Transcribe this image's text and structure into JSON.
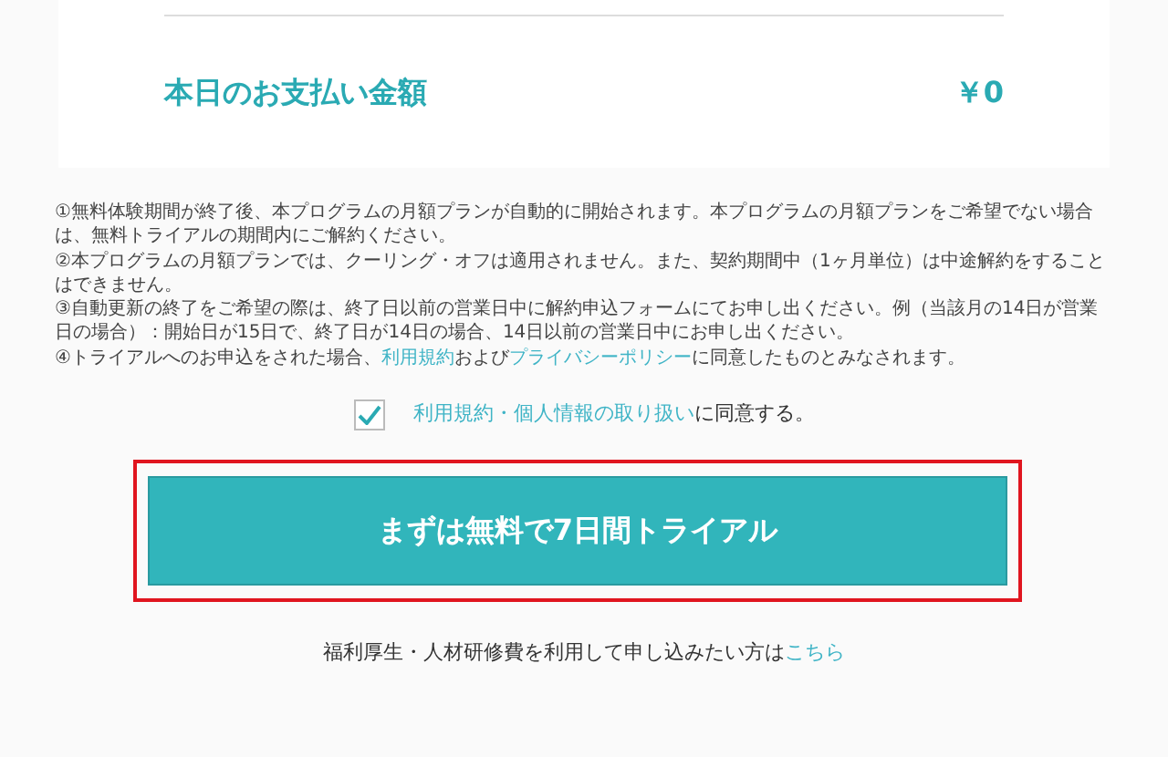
{
  "summary": {
    "label": "本日のお支払い金額",
    "amount": "￥0"
  },
  "notes": [
    {
      "parts": [
        {
          "kind": "text",
          "text": "①無料体験期間が終了後、本プログラムの月額プランが自動的に開始されます。本プログラムの月額プランをご希望でない場合は、無料トライアルの期間内にご解約ください。"
        }
      ]
    },
    {
      "parts": [
        {
          "kind": "text",
          "text": "②本プログラムの月額プランでは、クーリング・オフは適用されません。また、契約期間中（1ヶ月単位）は中途解約をすることはできません。"
        }
      ]
    },
    {
      "parts": [
        {
          "kind": "text",
          "text": "③自動更新の終了をご希望の際は、終了日以前の営業日中に解約申込フォームにてお申し出ください。例（当該月の14日が営業日の場合）：開始日が15日で、終了日が14日の場合、14日以前の営業日中にお申し出ください。"
        }
      ]
    },
    {
      "parts": [
        {
          "kind": "text",
          "text": "④トライアルへのお申込をされた場合、"
        },
        {
          "kind": "link",
          "text": "利用規約"
        },
        {
          "kind": "text",
          "text": "および"
        },
        {
          "kind": "link",
          "text": "プライバシーポリシー"
        },
        {
          "kind": "text",
          "text": "に同意したものとみなされます。"
        }
      ]
    }
  ],
  "agreement": {
    "checked": true,
    "link": "利用規約・個人情報の取り扱い",
    "text": "に同意する。"
  },
  "submit_button": {
    "label": "まずは無料で7日間トライアル",
    "highlighted": true
  },
  "footer": {
    "text": "福利厚生・人材研修費を利用して申し込みたい方は",
    "link": "こちら"
  }
}
